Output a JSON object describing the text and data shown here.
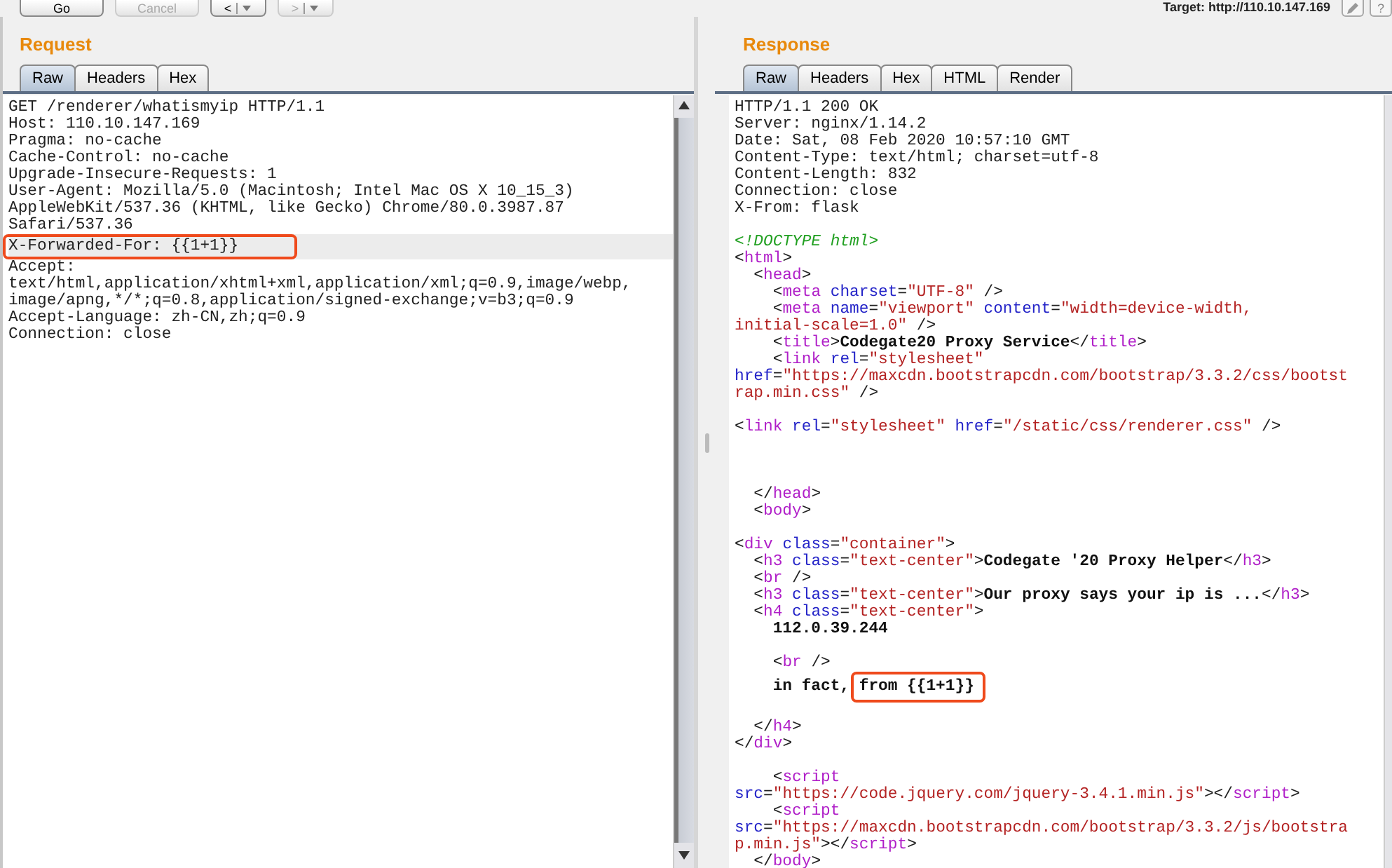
{
  "toolbar": {
    "buttons": [
      {
        "label": "Go",
        "disabled": false
      },
      {
        "label": "Cancel",
        "disabled": true
      },
      {
        "label": "<",
        "kind": "nav",
        "disabled": false
      },
      {
        "label": ">",
        "kind": "nav",
        "disabled": true
      }
    ],
    "target": "Target: http://110.10.147.169",
    "help": "?"
  },
  "request": {
    "title": "Request",
    "tabs": [
      {
        "label": "Raw",
        "selected": true
      },
      {
        "label": "Headers",
        "selected": false
      },
      {
        "label": "Hex",
        "selected": false
      }
    ],
    "lines": [
      {
        "text": "GET /renderer/whatismyip HTTP/1.1",
        "highlighted": false,
        "boxed": false
      },
      {
        "text": "Host: 110.10.147.169",
        "highlighted": false,
        "boxed": false
      },
      {
        "text": "Pragma: no-cache",
        "highlighted": false,
        "boxed": false
      },
      {
        "text": "Cache-Control: no-cache",
        "highlighted": false,
        "boxed": false
      },
      {
        "text": "Upgrade-Insecure-Requests: 1",
        "highlighted": false,
        "boxed": false
      },
      {
        "text": "User-Agent: Mozilla/5.0 (Macintosh; Intel Mac OS X 10_15_3)",
        "highlighted": false,
        "boxed": false
      },
      {
        "text": "AppleWebKit/537.36 (KHTML, like Gecko) Chrome/80.0.3987.87",
        "highlighted": false,
        "boxed": false
      },
      {
        "text": "Safari/537.36",
        "highlighted": false,
        "boxed": false
      },
      {
        "text": "X-Forwarded-For: {{1+1}}",
        "highlighted": true,
        "boxed": true
      },
      {
        "text": "Accept:",
        "highlighted": false,
        "boxed": false
      },
      {
        "text": "text/html,application/xhtml+xml,application/xml;q=0.9,image/webp,",
        "highlighted": false,
        "boxed": false
      },
      {
        "text": "image/apng,*/*;q=0.8,application/signed-exchange;v=b3;q=0.9",
        "highlighted": false,
        "boxed": false
      },
      {
        "text": "Accept-Language: zh-CN,zh;q=0.9",
        "highlighted": false,
        "boxed": false
      },
      {
        "text": "Connection: close",
        "highlighted": false,
        "boxed": false
      }
    ]
  },
  "response": {
    "title": "Response",
    "tabs": [
      {
        "label": "Raw",
        "selected": true
      },
      {
        "label": "Headers",
        "selected": false
      },
      {
        "label": "Hex",
        "selected": false
      },
      {
        "label": "HTML",
        "selected": false
      },
      {
        "label": "Render",
        "selected": false
      }
    ],
    "lines": [
      {
        "kind": "code",
        "segments": [
          {
            "kind": "plain",
            "text": "HTTP/1.1 200 OK"
          }
        ]
      },
      {
        "kind": "code",
        "segments": [
          {
            "kind": "plain",
            "text": "Server: nginx/1.14.2"
          }
        ]
      },
      {
        "kind": "code",
        "segments": [
          {
            "kind": "plain",
            "text": "Date: Sat, 08 Feb 2020 10:57:10 GMT"
          }
        ]
      },
      {
        "kind": "code",
        "segments": [
          {
            "kind": "plain",
            "text": "Content-Type: text/html; charset=utf-8"
          }
        ]
      },
      {
        "kind": "code",
        "segments": [
          {
            "kind": "plain",
            "text": "Content-Length: 832"
          }
        ]
      },
      {
        "kind": "code",
        "segments": [
          {
            "kind": "plain",
            "text": "Connection: close"
          }
        ]
      },
      {
        "kind": "code",
        "segments": [
          {
            "kind": "plain",
            "text": "X-From: flask"
          }
        ]
      },
      {
        "kind": "blank"
      },
      {
        "kind": "code",
        "segments": [
          {
            "kind": "doctype",
            "text": "<!DOCTYPE html>"
          }
        ]
      },
      {
        "kind": "code",
        "segments": [
          {
            "kind": "plain",
            "text": "<"
          },
          {
            "kind": "tag",
            "text": "html"
          },
          {
            "kind": "plain",
            "text": ">"
          }
        ]
      },
      {
        "kind": "code",
        "segments": [
          {
            "kind": "plain",
            "text": "  <"
          },
          {
            "kind": "tag",
            "text": "head"
          },
          {
            "kind": "plain",
            "text": ">"
          }
        ]
      },
      {
        "kind": "code",
        "segments": [
          {
            "kind": "plain",
            "text": "    <"
          },
          {
            "kind": "tag",
            "text": "meta"
          },
          {
            "kind": "attr",
            "text": " charset"
          },
          {
            "kind": "plain",
            "text": "="
          },
          {
            "kind": "value",
            "text": "\"UTF-8\""
          },
          {
            "kind": "plain",
            "text": " />"
          }
        ]
      },
      {
        "kind": "code",
        "segments": [
          {
            "kind": "plain",
            "text": "    <"
          },
          {
            "kind": "tag",
            "text": "meta"
          },
          {
            "kind": "attr",
            "text": " name"
          },
          {
            "kind": "plain",
            "text": "="
          },
          {
            "kind": "value",
            "text": "\"viewport\""
          },
          {
            "kind": "attr",
            "text": " content"
          },
          {
            "kind": "plain",
            "text": "="
          },
          {
            "kind": "value",
            "text": "\"width=device-width,"
          }
        ]
      },
      {
        "kind": "code",
        "segments": [
          {
            "kind": "value",
            "text": "initial-scale=1.0\""
          },
          {
            "kind": "plain",
            "text": " />"
          }
        ]
      },
      {
        "kind": "code",
        "segments": [
          {
            "kind": "plain",
            "text": "    <"
          },
          {
            "kind": "tag",
            "text": "title"
          },
          {
            "kind": "plain",
            "text": ">"
          },
          {
            "kind": "bold",
            "text": "Codegate20 Proxy Service"
          },
          {
            "kind": "plain",
            "text": "</"
          },
          {
            "kind": "tag",
            "text": "title"
          },
          {
            "kind": "plain",
            "text": ">"
          }
        ]
      },
      {
        "kind": "code",
        "segments": [
          {
            "kind": "plain",
            "text": "    <"
          },
          {
            "kind": "tag",
            "text": "link"
          },
          {
            "kind": "attr",
            "text": " rel"
          },
          {
            "kind": "plain",
            "text": "="
          },
          {
            "kind": "value",
            "text": "\"stylesheet\""
          }
        ]
      },
      {
        "kind": "code",
        "segments": [
          {
            "kind": "attr",
            "text": "href"
          },
          {
            "kind": "plain",
            "text": "="
          },
          {
            "kind": "value",
            "text": "\"https://maxcdn.bootstrapcdn.com/bootstrap/3.3.2/css/bootst"
          }
        ]
      },
      {
        "kind": "code",
        "segments": [
          {
            "kind": "value",
            "text": "rap.min.css\""
          },
          {
            "kind": "plain",
            "text": " />"
          }
        ]
      },
      {
        "kind": "blank"
      },
      {
        "kind": "code",
        "segments": [
          {
            "kind": "plain",
            "text": "<"
          },
          {
            "kind": "tag",
            "text": "link"
          },
          {
            "kind": "attr",
            "text": " rel"
          },
          {
            "kind": "plain",
            "text": "="
          },
          {
            "kind": "value",
            "text": "\"stylesheet\""
          },
          {
            "kind": "attr",
            "text": " href"
          },
          {
            "kind": "plain",
            "text": "="
          },
          {
            "kind": "value",
            "text": "\"/static/css/renderer.css\""
          },
          {
            "kind": "plain",
            "text": " />"
          }
        ]
      },
      {
        "kind": "blank"
      },
      {
        "kind": "blank"
      },
      {
        "kind": "blank"
      },
      {
        "kind": "code",
        "segments": [
          {
            "kind": "plain",
            "text": "  </"
          },
          {
            "kind": "tag",
            "text": "head"
          },
          {
            "kind": "plain",
            "text": ">"
          }
        ]
      },
      {
        "kind": "code",
        "segments": [
          {
            "kind": "plain",
            "text": "  <"
          },
          {
            "kind": "tag",
            "text": "body"
          },
          {
            "kind": "plain",
            "text": ">"
          }
        ]
      },
      {
        "kind": "blank"
      },
      {
        "kind": "code",
        "segments": [
          {
            "kind": "plain",
            "text": "<"
          },
          {
            "kind": "tag",
            "text": "div"
          },
          {
            "kind": "attr",
            "text": " class"
          },
          {
            "kind": "plain",
            "text": "="
          },
          {
            "kind": "value",
            "text": "\"container\""
          },
          {
            "kind": "plain",
            "text": ">"
          }
        ]
      },
      {
        "kind": "code",
        "segments": [
          {
            "kind": "plain",
            "text": "  <"
          },
          {
            "kind": "tag",
            "text": "h3"
          },
          {
            "kind": "attr",
            "text": " class"
          },
          {
            "kind": "plain",
            "text": "="
          },
          {
            "kind": "value",
            "text": "\"text-center\""
          },
          {
            "kind": "plain",
            "text": ">"
          },
          {
            "kind": "bold",
            "text": "Codegate '20 Proxy Helper"
          },
          {
            "kind": "plain",
            "text": "</"
          },
          {
            "kind": "tag",
            "text": "h3"
          },
          {
            "kind": "plain",
            "text": ">"
          }
        ]
      },
      {
        "kind": "code",
        "segments": [
          {
            "kind": "plain",
            "text": "  <"
          },
          {
            "kind": "tag",
            "text": "br"
          },
          {
            "kind": "plain",
            "text": " />"
          }
        ]
      },
      {
        "kind": "code",
        "segments": [
          {
            "kind": "plain",
            "text": "  <"
          },
          {
            "kind": "tag",
            "text": "h3"
          },
          {
            "kind": "attr",
            "text": " class"
          },
          {
            "kind": "plain",
            "text": "="
          },
          {
            "kind": "value",
            "text": "\"text-center\""
          },
          {
            "kind": "plain",
            "text": ">"
          },
          {
            "kind": "bold",
            "text": "Our proxy says your ip is ..."
          },
          {
            "kind": "plain",
            "text": "</"
          },
          {
            "kind": "tag",
            "text": "h3"
          },
          {
            "kind": "plain",
            "text": ">"
          }
        ]
      },
      {
        "kind": "code",
        "segments": [
          {
            "kind": "plain",
            "text": "  <"
          },
          {
            "kind": "tag",
            "text": "h4"
          },
          {
            "kind": "attr",
            "text": " class"
          },
          {
            "kind": "plain",
            "text": "="
          },
          {
            "kind": "value",
            "text": "\"text-center\""
          },
          {
            "kind": "plain",
            "text": ">"
          }
        ]
      },
      {
        "kind": "code",
        "segments": [
          {
            "kind": "bold",
            "text": "    112.0.39.244"
          }
        ]
      },
      {
        "kind": "blank"
      },
      {
        "kind": "code",
        "segments": [
          {
            "kind": "plain",
            "text": "    <"
          },
          {
            "kind": "tag",
            "text": "br"
          },
          {
            "kind": "plain",
            "text": " />"
          }
        ]
      },
      {
        "kind": "code",
        "segments": [
          {
            "kind": "bold",
            "text": "    in fact, "
          },
          {
            "kind": "boxed",
            "text": "from {{1+1}}"
          }
        ]
      },
      {
        "kind": "blank"
      },
      {
        "kind": "code",
        "segments": [
          {
            "kind": "plain",
            "text": "  </"
          },
          {
            "kind": "tag",
            "text": "h4"
          },
          {
            "kind": "plain",
            "text": ">"
          }
        ]
      },
      {
        "kind": "code",
        "segments": [
          {
            "kind": "plain",
            "text": "</"
          },
          {
            "kind": "tag",
            "text": "div"
          },
          {
            "kind": "plain",
            "text": ">"
          }
        ]
      },
      {
        "kind": "blank"
      },
      {
        "kind": "code",
        "segments": [
          {
            "kind": "plain",
            "text": "    <"
          },
          {
            "kind": "tag",
            "text": "script"
          }
        ]
      },
      {
        "kind": "code",
        "segments": [
          {
            "kind": "attr",
            "text": "src"
          },
          {
            "kind": "plain",
            "text": "="
          },
          {
            "kind": "value",
            "text": "\"https://code.jquery.com/jquery-3.4.1.min.js\""
          },
          {
            "kind": "plain",
            "text": "></"
          },
          {
            "kind": "tag",
            "text": "script"
          },
          {
            "kind": "plain",
            "text": ">"
          }
        ]
      },
      {
        "kind": "code",
        "segments": [
          {
            "kind": "plain",
            "text": "    <"
          },
          {
            "kind": "tag",
            "text": "script"
          }
        ]
      },
      {
        "kind": "code",
        "segments": [
          {
            "kind": "attr",
            "text": "src"
          },
          {
            "kind": "plain",
            "text": "="
          },
          {
            "kind": "value",
            "text": "\"https://maxcdn.bootstrapcdn.com/bootstrap/3.3.2/js/bootstra"
          }
        ]
      },
      {
        "kind": "code",
        "segments": [
          {
            "kind": "value",
            "text": "p.min.js\""
          },
          {
            "kind": "plain",
            "text": "></"
          },
          {
            "kind": "tag",
            "text": "script"
          },
          {
            "kind": "plain",
            "text": ">"
          }
        ]
      },
      {
        "kind": "code",
        "segments": [
          {
            "kind": "plain",
            "text": "  </"
          },
          {
            "kind": "tag",
            "text": "body"
          },
          {
            "kind": "plain",
            "text": ">"
          }
        ]
      }
    ]
  }
}
